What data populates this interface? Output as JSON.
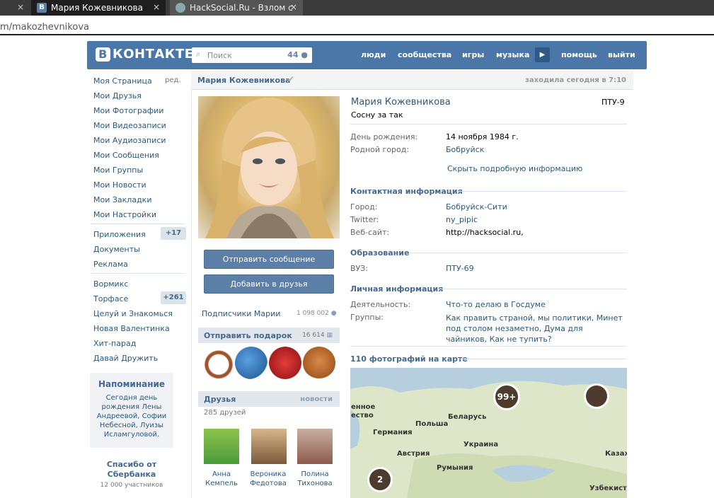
{
  "browser": {
    "tab1_title": "Мария Кожевникова",
    "tab2_title": "HackSocial.Ru - Взлом с",
    "tab_close": "×",
    "tab_close_left": "×",
    "address": "m/makozhevnikova",
    "vk_favicon": "B"
  },
  "header": {
    "logo_letter": "B",
    "logo_text": "КОНТАКТЕ",
    "search_placeholder": "Поиск",
    "search_count": "44",
    "nav": [
      "люди",
      "сообщества",
      "игры",
      "музыка",
      "помощь",
      "выйти"
    ],
    "play_icon": "▶"
  },
  "left_menu": {
    "items": [
      "Моя Страница",
      "Мои Друзья",
      "Мои Фотографии",
      "Мои Видеозаписи",
      "Мои Аудиозаписи",
      "Мои Сообщения",
      "Мои Группы",
      "Мои Новости",
      "Мои Закладки",
      "Мои Настройки"
    ],
    "edit": "ред.",
    "apps": [
      "Приложения",
      "Документы",
      "Реклама"
    ],
    "apps_badge": "+17",
    "games": [
      "Вормикс",
      "Торфасе",
      "Целуй и Знакомься",
      "Новая Валентинка",
      "Хит-парад",
      "Давай Дружить"
    ],
    "games_badge": "+261"
  },
  "reminder": {
    "title": "Напоминание",
    "text": "Сегодня день рождения Лены Андреевой, Софии Небесной, Луизы Исламгуловой."
  },
  "sber": {
    "title": "Спасибо от Сбербанка",
    "members": "12 000 участников"
  },
  "profile": {
    "name": "Мария Кожевникова",
    "online": "заходила сегодня в 7:10",
    "status": "Сосну за так",
    "school": "ПТУ-9",
    "send_message": "Отправить сообщение",
    "add_friend": "Добавить в друзья",
    "subscribers_label": "Подписчики Марии",
    "subscribers_count": "1 098 002",
    "gifts_title": "Отправить подарок",
    "gifts_count": "16 614",
    "friends_title": "Друзья",
    "friends_news": "новости",
    "friends_count": "285 друзей",
    "friends": [
      {
        "first": "Анна",
        "last": "Кемпель"
      },
      {
        "first": "Вероника",
        "last": "Федотова"
      },
      {
        "first": "Полина",
        "last": "Тихонова"
      }
    ]
  },
  "info": {
    "birthday_label": "День рождения:",
    "birthday": "14 ноября 1984 г.",
    "hometown_label": "Родной город:",
    "hometown": "Бобруйск",
    "hide_details": "Скрыть подробную информацию",
    "contact_title": "Контактная информация",
    "city_label": "Город:",
    "city": "Бобруйск-Сити",
    "twitter_label": "Twitter:",
    "twitter": "ny_pipic",
    "website_label": "Веб-сайт:",
    "website": "http://hacksocial.ru",
    "website_comma": ",",
    "education_title": "Образование",
    "uni_label": "ВУЗ:",
    "uni": "ПТУ-69",
    "personal_title": "Личная информация",
    "activity_label": "Деятельность:",
    "activity": "Что-то делаю в Госдуме",
    "groups_label": "Группы:",
    "groups": "Как править страной, мы политики, Минет под столом незаметно, Дума для чайников, Как не тупить?",
    "map_title": "110 фотографий на карте"
  },
  "map": {
    "labels": [
      "енное",
      "ество",
      "Германия",
      "Польша",
      "Беларусь",
      "Украина",
      "Австрия",
      "Румыния",
      "Казах",
      "Узбекиста"
    ],
    "marker_big": "99+",
    "marker_small": "2"
  }
}
